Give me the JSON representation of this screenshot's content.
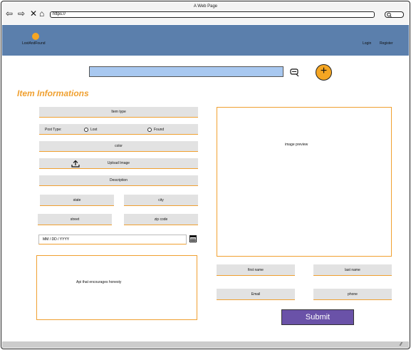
{
  "window": {
    "title": "A Web Page",
    "url": "https://"
  },
  "header": {
    "brand": "LostAndFound",
    "login": "Login",
    "register": "Register"
  },
  "search": {
    "value": ""
  },
  "section_title": "Item Informations",
  "form": {
    "item_type": "Item type",
    "post_type_label": "Post Type:",
    "lost": "Lost",
    "found": "Found",
    "color": "color",
    "upload_image": "Upload Image",
    "description": "Description",
    "state": "state",
    "city": "city",
    "street": "street",
    "zip_code": "zip code",
    "date_placeholder": "MM / DD /   YYYY",
    "honesty_text": "Api that encourages honesty",
    "image_preview": "image preview",
    "first_name": "first name",
    "last_name": "last name",
    "email": "Email",
    "phone": "phone",
    "submit": "Submit"
  },
  "colors": {
    "header": "#5b7fac",
    "accent": "#f0a030",
    "submit": "#6a52a8",
    "search": "#a8c8f0"
  }
}
